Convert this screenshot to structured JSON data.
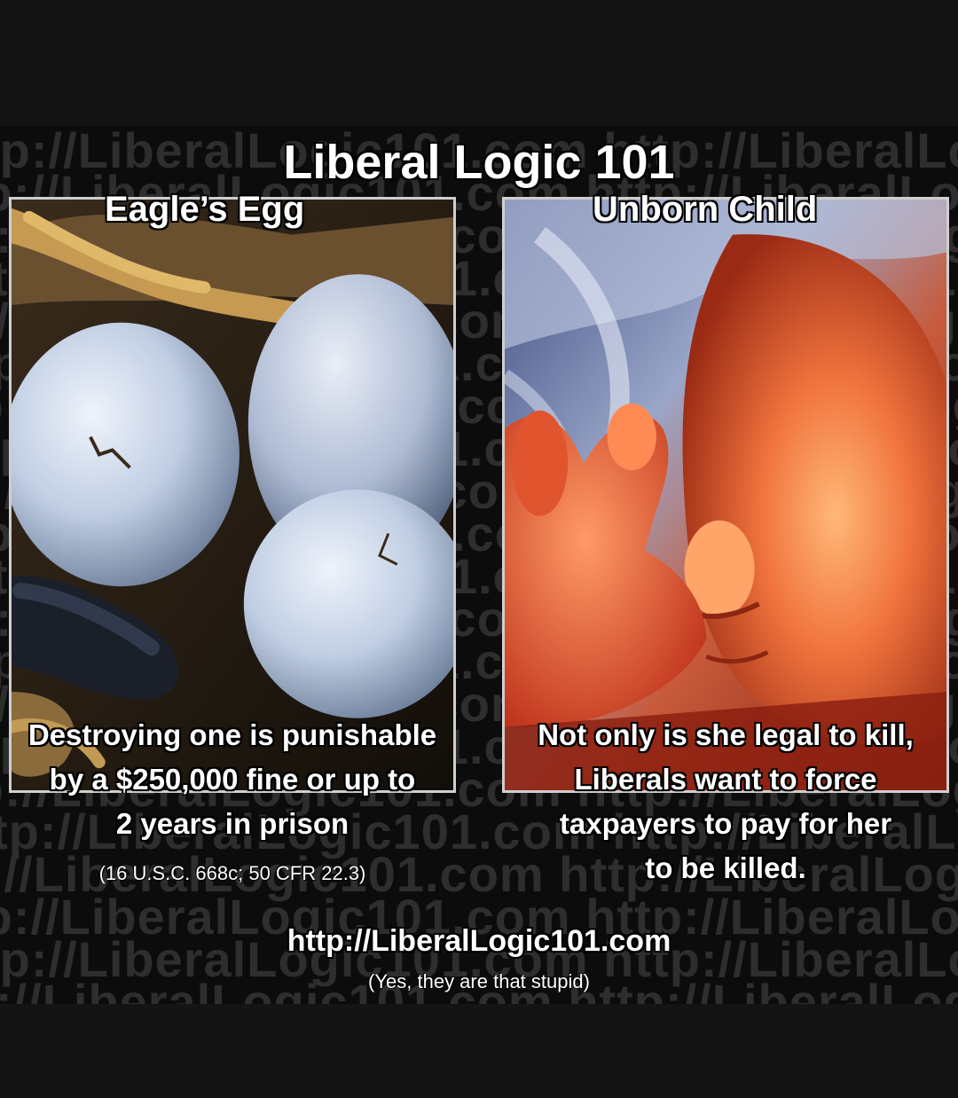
{
  "meme": {
    "title": "Liberal Logic 101",
    "watermark_text": "tp://LiberalLogic101.com http://LiberalLogic101.com http://LiberalLogic101.com",
    "left_panel": {
      "label": "Eagle’s Egg",
      "caption_lines": [
        "Destroying one is punishable",
        "by a $250,000 fine or up to",
        "2 years in prison"
      ],
      "citation": "(16 U.S.C. 668c; 50 CFR 22.3)"
    },
    "right_panel": {
      "label": "Unborn Child",
      "caption_lines": [
        "Not only is she legal to kill,",
        "Liberals want to force",
        "taxpayers to pay for her",
        "to be killed."
      ]
    },
    "url": "http://LiberalLogic101.com",
    "tagline": "(Yes, they are that stupid)"
  },
  "colors": {
    "background": "#141414",
    "text": "#ffffff",
    "watermark": "#2e2e2e",
    "panel_border": "#cfcfcf"
  }
}
